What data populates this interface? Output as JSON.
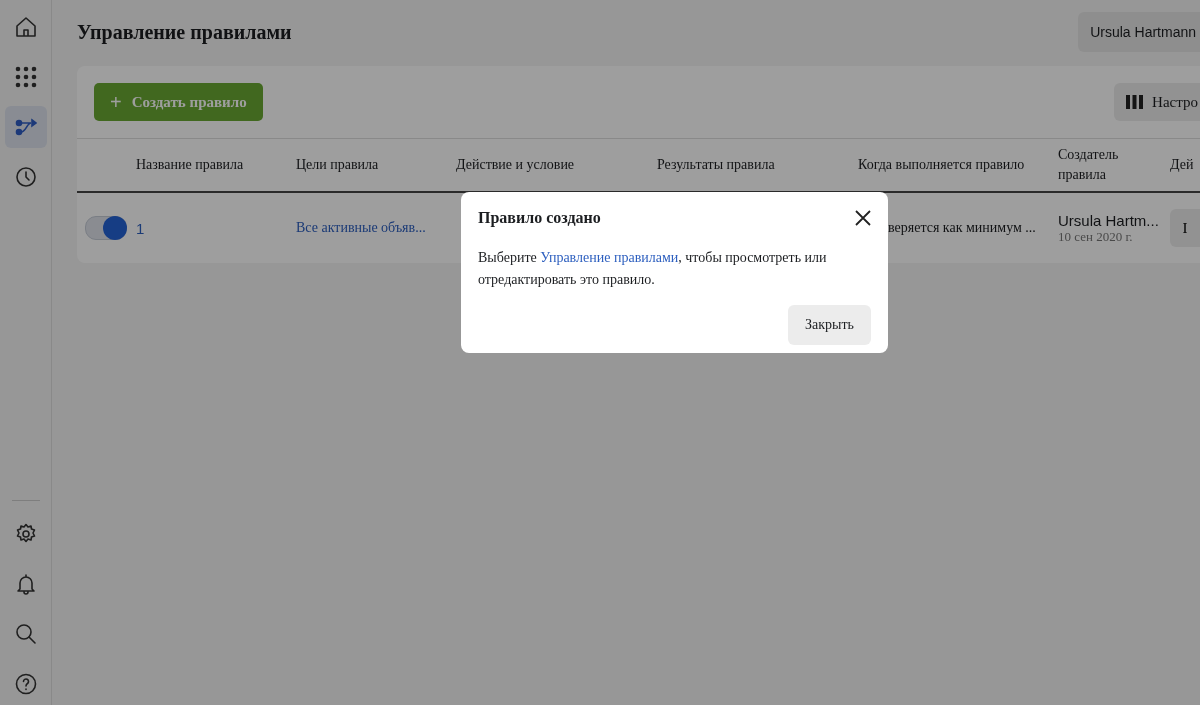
{
  "page_title": "Управление правилами",
  "account": {
    "name": "Ursula Hartmann"
  },
  "toolbar": {
    "create_button": {
      "icon": "+",
      "label": "Создать правило"
    },
    "columns_button": {
      "label": "Настро"
    }
  },
  "table": {
    "columns": [
      "Название правила",
      "Цели правила",
      "Действие и условие",
      "Результаты правила",
      "Когда выполняется правило",
      "Создатель правила",
      "Дей"
    ],
    "rows": [
      {
        "on": true,
        "name": "1",
        "targets": "Все активные объяв...",
        "when": "веряется как минимум ...",
        "creator": "Ursula Hartm...",
        "created": "10 сен 2020 г.",
        "action_button": "I"
      }
    ]
  },
  "dialog": {
    "title": "Правило создано",
    "text_before": "Выберите ",
    "link": "Управление правилами",
    "text_after": ", чтобы просмотреть или отредактировать это правило.",
    "close_button": "Закрыть"
  }
}
